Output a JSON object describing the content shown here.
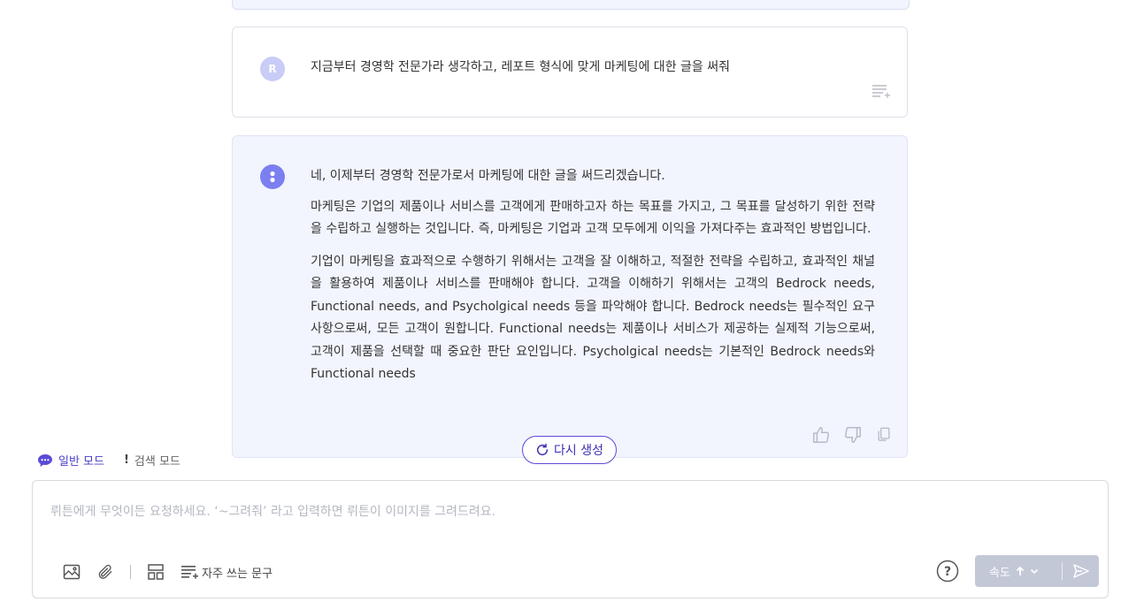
{
  "user_message": {
    "avatar_letter": "R",
    "text": "지금부터 경영학 전문가라 생각하고, 레포트 형식에 맞게 마케팅에 대한 글을 써줘"
  },
  "bot_message": {
    "paragraphs": [
      "네, 이제부터 경영학 전문가로서 마케팅에 대한 글을 써드리겠습니다.",
      "마케팅은 기업의 제품이나 서비스를 고객에게 판매하고자 하는 목표를 가지고, 그 목표를 달성하기 위한 전략을 수립하고 실행하는 것입니다. 즉, 마케팅은 기업과 고객 모두에게 이익을 가져다주는 효과적인 방법입니다.",
      "기업이 마케팅을 효과적으로 수행하기 위해서는 고객을 잘 이해하고, 적절한 전략을 수립하고, 효과적인 채널을 활용하여 제품이나 서비스를 판매해야 합니다. 고객을 이해하기 위해서는 고객의 Bedrock needs, Functional needs, and Psycholgical needs 등을 파악해야 합니다. Bedrock needs는 필수적인 요구사항으로써, 모든 고객이 원합니다. Functional needs는 제품이나 서비스가 제공하는 실제적 기능으로써, 고객이 제품을 선택할 때 중요한 판단 요인입니다. Psycholgical needs는 기본적인 Bedrock needs와 Functional needs"
    ]
  },
  "regenerate_label": "다시 생성",
  "modes": {
    "normal": "일반 모드",
    "search": "검색 모드"
  },
  "input": {
    "placeholder": "뤼튼에게 무엇이든 요청하세요.  ‘~그려줘’ 라고 입력하면 뤼튼이 이미지를 그려드려요."
  },
  "toolbar": {
    "phrases_label": "자주 쓰는 문구",
    "speed_label": "속도"
  },
  "colors": {
    "accent": "#4a3fc7",
    "bot_bg": "#f2f5fe",
    "send_disabled": "#c3c8d6"
  }
}
